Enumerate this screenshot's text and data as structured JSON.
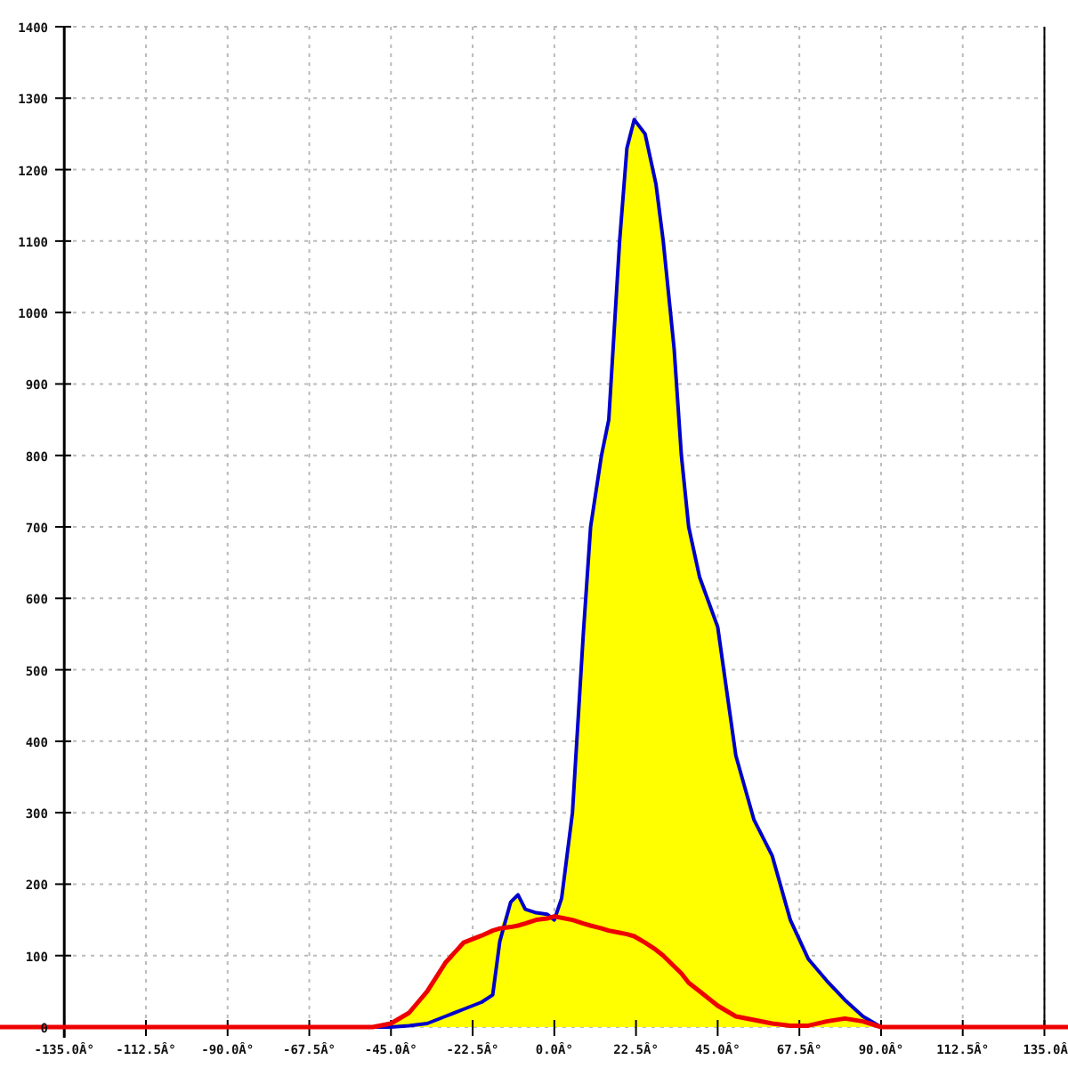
{
  "chart_data": {
    "type": "line",
    "x": [
      -152.7,
      -50,
      -45,
      -40,
      -35,
      -30,
      -25,
      -20,
      -17,
      -15,
      -12,
      -10,
      -8,
      -5,
      -2,
      0,
      2,
      5,
      8,
      10,
      13,
      15,
      18,
      20,
      22,
      25,
      28,
      30,
      33,
      35,
      37,
      40,
      45,
      50,
      55,
      60,
      65,
      70,
      75,
      80,
      85,
      90,
      141.5
    ],
    "series": [
      {
        "color": "#0000cc",
        "values": [
          0,
          0,
          0,
          2,
          5,
          15,
          25,
          35,
          45,
          120,
          175,
          185,
          165,
          160,
          158,
          150,
          180,
          300,
          550,
          700,
          800,
          850,
          1100,
          1230,
          1270,
          1250,
          1180,
          1100,
          950,
          800,
          700,
          630,
          560,
          380,
          290,
          240,
          150,
          95,
          65,
          38,
          15,
          0,
          0
        ]
      },
      {
        "color": "#ee0000",
        "values": [
          0,
          0,
          5,
          20,
          50,
          90,
          118,
          128,
          135,
          138,
          140,
          142,
          145,
          150,
          152,
          155,
          153,
          150,
          145,
          142,
          138,
          135,
          132,
          130,
          127,
          118,
          108,
          100,
          85,
          75,
          62,
          50,
          30,
          15,
          10,
          5,
          2,
          2,
          8,
          12,
          8,
          0,
          0
        ]
      }
    ],
    "grid": true,
    "ref_lines": [
      {
        "axis": "x",
        "value": 135,
        "color": "#000000"
      }
    ],
    "xlim": [
      -152.7,
      141.5
    ],
    "ylim": [
      0,
      1400
    ],
    "xticks": [
      {
        "value": -135,
        "label": "-135.0Â°"
      },
      {
        "value": -112.5,
        "label": "-112.5Â°"
      },
      {
        "value": -90,
        "label": "-90.0Â°"
      },
      {
        "value": -67.5,
        "label": "-67.5Â°"
      },
      {
        "value": -45,
        "label": "-45.0Â°"
      },
      {
        "value": -22.5,
        "label": "-22.5Â°"
      },
      {
        "value": 0,
        "label": "0.0Â°"
      },
      {
        "value": 22.5,
        "label": "22.5Â°"
      },
      {
        "value": 45,
        "label": "45.0Â°"
      },
      {
        "value": 67.5,
        "label": "67.5Â°"
      },
      {
        "value": 90,
        "label": "90.0Â°"
      },
      {
        "value": 112.5,
        "label": "112.5Â°"
      },
      {
        "value": 135,
        "label": "135.0Â"
      }
    ],
    "yticks": [
      0,
      100,
      200,
      300,
      400,
      500,
      600,
      700,
      800,
      900,
      1000,
      1100,
      1200,
      1300,
      1400
    ]
  }
}
